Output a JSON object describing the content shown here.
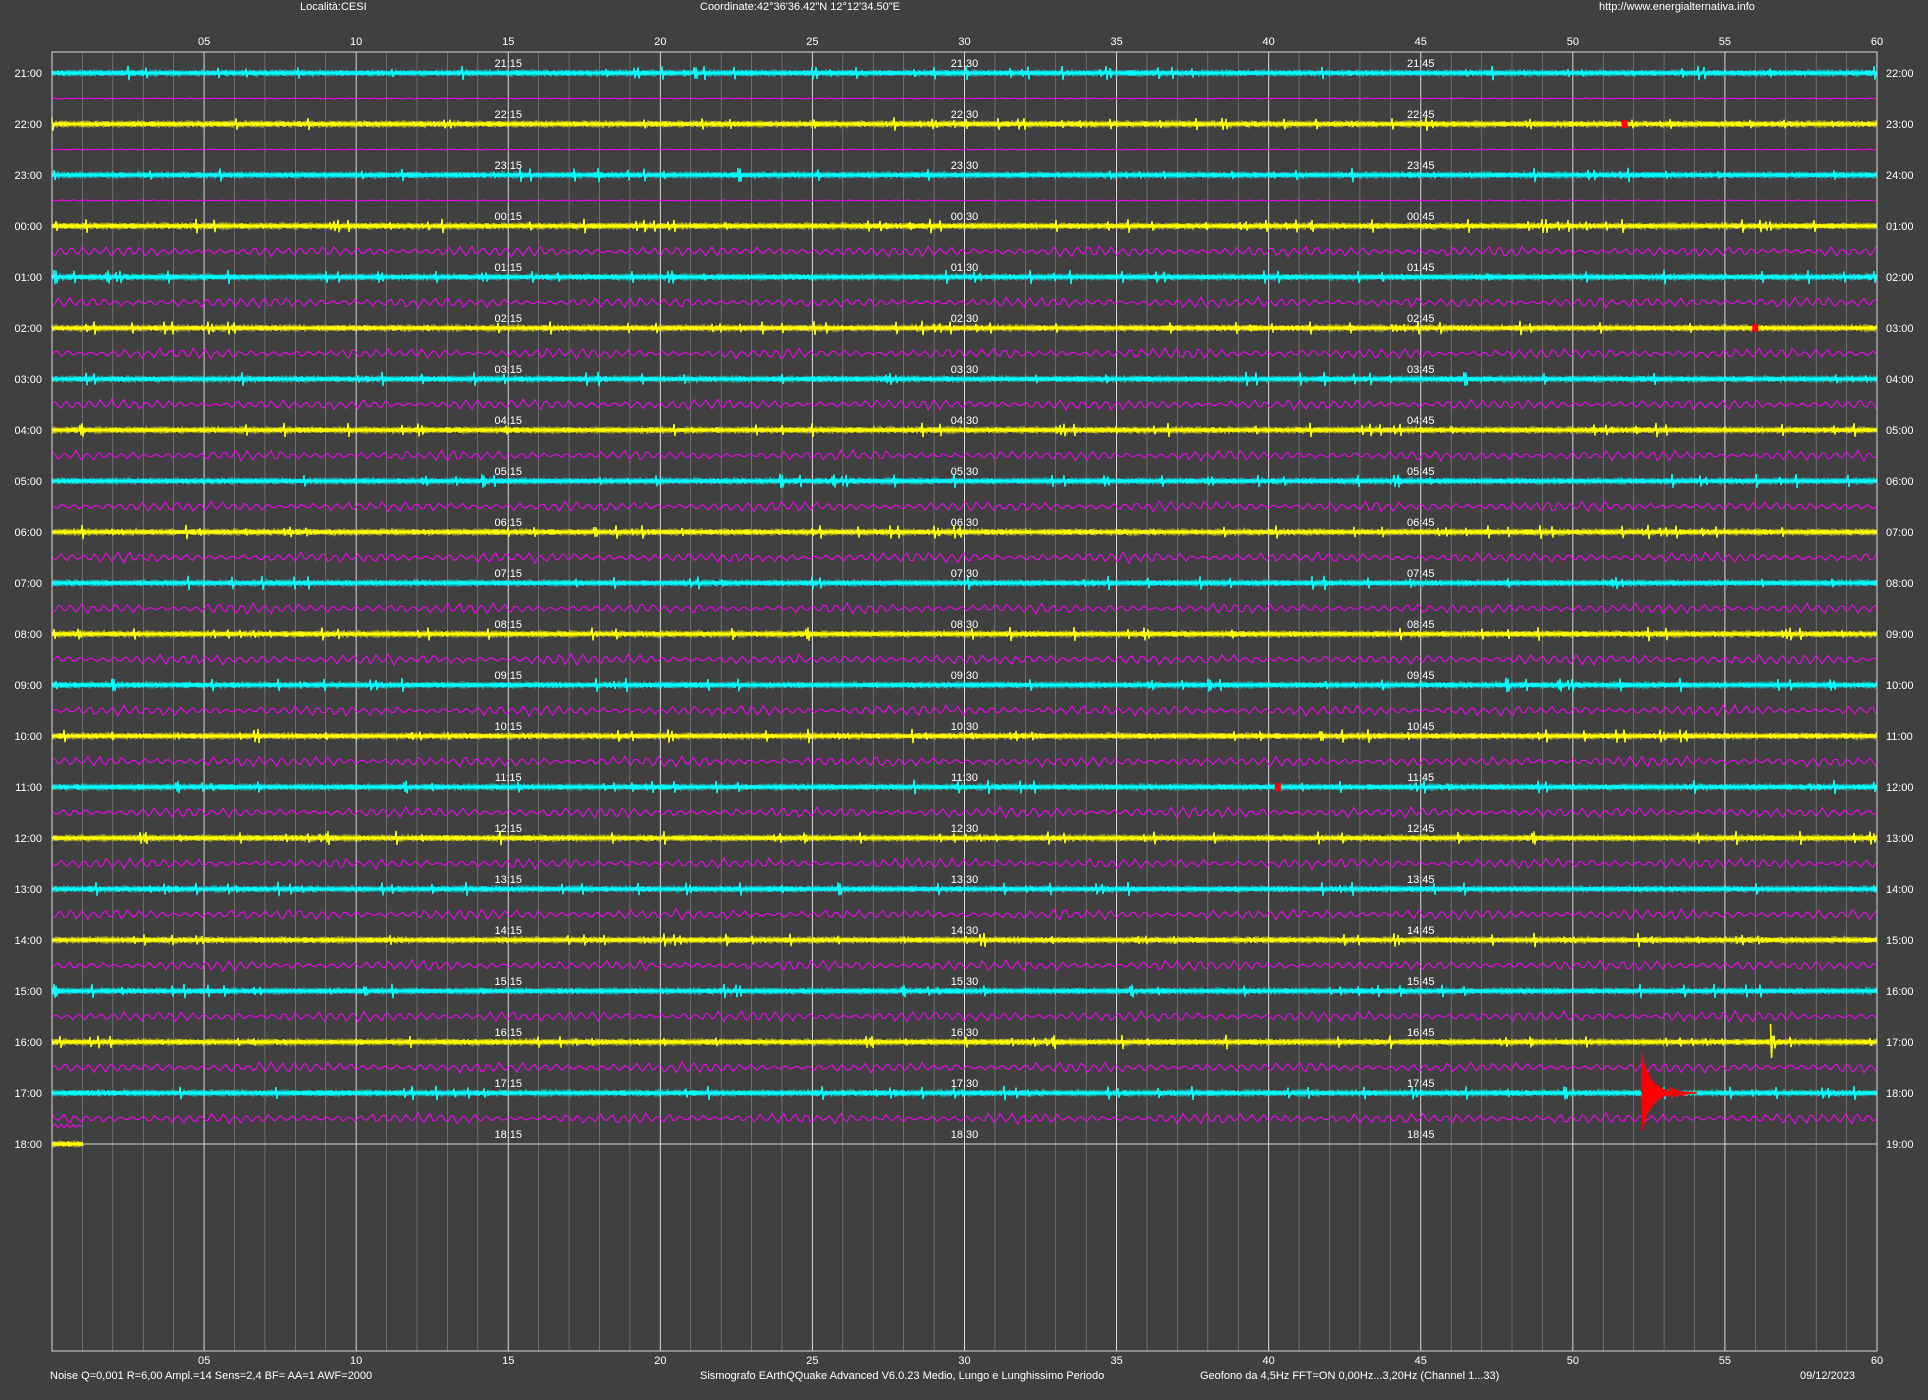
{
  "header": {
    "location": "Località:CESI",
    "coordinates": "Coordinate:42°36'36.42\"N  12°12'34.50\"E",
    "website": "http://www.energialternativa.info"
  },
  "footer": {
    "params": "Noise Q=0,001 R=6,00 Ampl.=14 Sens=2,4 BF= AA=1 AWF=2000",
    "software": "Sismografo  EArthQQuake Advanced V6.0.23  Medio, Lungo e Lunghissimo Periodo",
    "sensor": "Geofono da 4,5Hz FFT=ON 0,00Hz...3,20Hz      (Channel 1...33)",
    "date": "09/12/2023"
  },
  "colors": {
    "background": "#404040",
    "trace_odd": "#00ffff",
    "trace_even": "#ffff00",
    "divider": "#ff00ff",
    "event": "#ff0000",
    "grid_major": "#d8d8d8",
    "grid_minor": "#8a8a8a",
    "text": "#ffffff"
  },
  "chart_data": {
    "type": "line",
    "title": "",
    "x_unit": "minutes",
    "xlim": [
      0,
      60
    ],
    "x_ticks": [
      "05",
      "10",
      "15",
      "20",
      "25",
      "30",
      "35",
      "40",
      "45",
      "50",
      "55",
      "60"
    ],
    "quarter_hour_marks_at_minutes": [
      15,
      30,
      45
    ],
    "rows": [
      {
        "left": "21:00",
        "right": "22:00",
        "marks": [
          "21:15",
          "21:30",
          "21:45"
        ]
      },
      {
        "left": "22:00",
        "right": "23:00",
        "marks": [
          "22:15",
          "22:30",
          "22:45"
        ]
      },
      {
        "left": "23:00",
        "right": "24:00",
        "marks": [
          "23:15",
          "23:30",
          "23:45"
        ]
      },
      {
        "left": "00:00",
        "right": "01:00",
        "marks": [
          "00:15",
          "00:30",
          "00:45"
        ]
      },
      {
        "left": "01:00",
        "right": "02:00",
        "marks": [
          "01:15",
          "01:30",
          "01:45"
        ]
      },
      {
        "left": "02:00",
        "right": "03:00",
        "marks": [
          "02:15",
          "02:30",
          "02:45"
        ]
      },
      {
        "left": "03:00",
        "right": "04:00",
        "marks": [
          "03:15",
          "03:30",
          "03:45"
        ]
      },
      {
        "left": "04:00",
        "right": "05:00",
        "marks": [
          "04:15",
          "04:30",
          "04:45"
        ]
      },
      {
        "left": "05:00",
        "right": "06:00",
        "marks": [
          "05:15",
          "05:30",
          "05:45"
        ]
      },
      {
        "left": "06:00",
        "right": "07:00",
        "marks": [
          "06:15",
          "06:30",
          "06:45"
        ]
      },
      {
        "left": "07:00",
        "right": "08:00",
        "marks": [
          "07:15",
          "07:30",
          "07:45"
        ]
      },
      {
        "left": "08:00",
        "right": "09:00",
        "marks": [
          "08:15",
          "08:30",
          "08:45"
        ]
      },
      {
        "left": "09:00",
        "right": "10:00",
        "marks": [
          "09:15",
          "09:30",
          "09:45"
        ]
      },
      {
        "left": "10:00",
        "right": "11:00",
        "marks": [
          "10:15",
          "10:30",
          "10:45"
        ]
      },
      {
        "left": "11:00",
        "right": "12:00",
        "marks": [
          "11:15",
          "11:30",
          "11:45"
        ]
      },
      {
        "left": "12:00",
        "right": "13:00",
        "marks": [
          "12:15",
          "12:30",
          "12:45"
        ]
      },
      {
        "left": "13:00",
        "right": "14:00",
        "marks": [
          "13:15",
          "13:30",
          "13:45"
        ]
      },
      {
        "left": "14:00",
        "right": "15:00",
        "marks": [
          "14:15",
          "14:30",
          "14:45"
        ]
      },
      {
        "left": "15:00",
        "right": "16:00",
        "marks": [
          "15:15",
          "15:30",
          "15:45"
        ]
      },
      {
        "left": "16:00",
        "right": "17:00",
        "marks": [
          "16:15",
          "16:30",
          "16:45"
        ]
      },
      {
        "left": "17:00",
        "right": "18:00",
        "marks": [
          "17:15",
          "17:30",
          "17:45"
        ]
      },
      {
        "left": "18:00",
        "right": "19:00",
        "marks": [
          "18:15",
          "18:30",
          "18:45"
        ]
      }
    ],
    "last_row_recorded_until_minute": 1,
    "events": [
      {
        "row": "22:00",
        "minute": 51.7,
        "magnitude": "small"
      },
      {
        "row": "02:00",
        "minute": 56.0,
        "magnitude": "small"
      },
      {
        "row": "11:00",
        "minute": 40.3,
        "magnitude": "small"
      },
      {
        "row": "16:00",
        "minute": 56.5,
        "magnitude": "spike"
      },
      {
        "row": "17:00",
        "minute": 52.4,
        "magnitude": "large"
      }
    ]
  }
}
